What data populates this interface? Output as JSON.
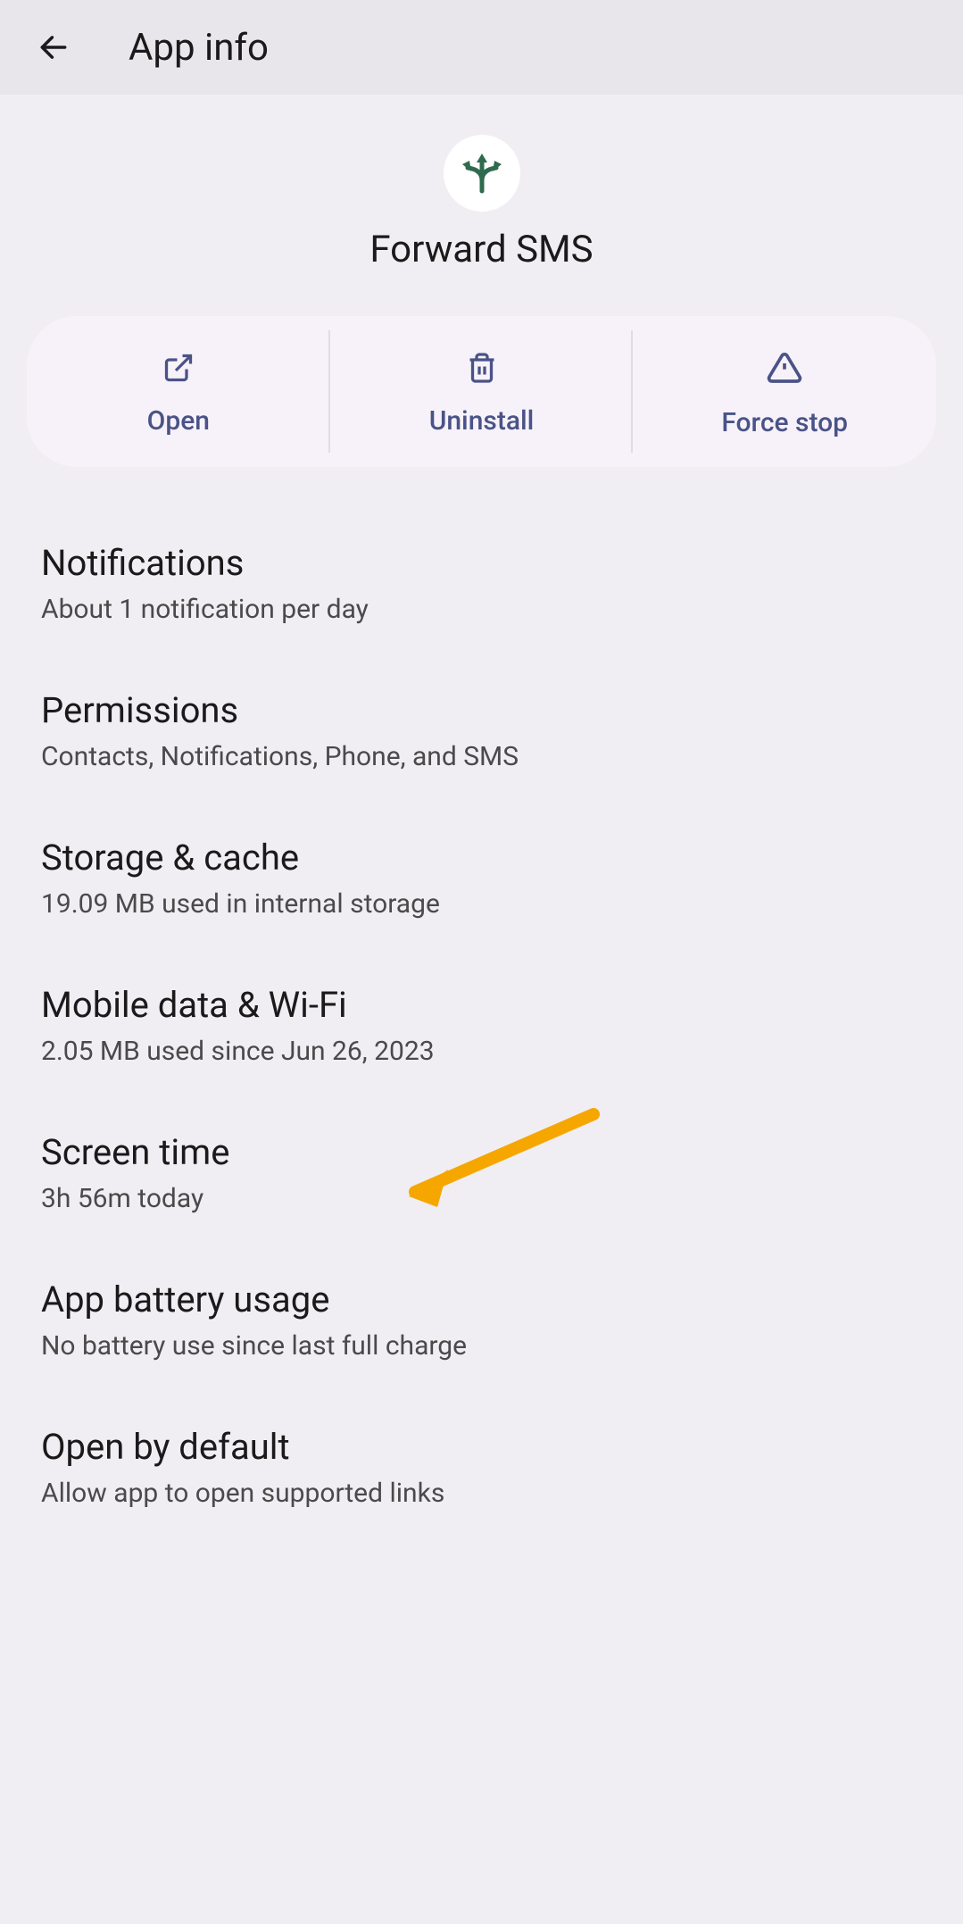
{
  "header": {
    "title": "App info"
  },
  "app": {
    "name": "Forward SMS",
    "icon": "forward-arrows-icon"
  },
  "actions": {
    "open": "Open",
    "uninstall": "Uninstall",
    "force_stop": "Force stop"
  },
  "settings": [
    {
      "title": "Notifications",
      "subtitle": "About 1 notification per day"
    },
    {
      "title": "Permissions",
      "subtitle": "Contacts, Notifications, Phone, and SMS"
    },
    {
      "title": "Storage & cache",
      "subtitle": "19.09 MB used in internal storage"
    },
    {
      "title": "Mobile data & Wi-Fi",
      "subtitle": "2.05 MB used since Jun 26, 2023"
    },
    {
      "title": "Screen time",
      "subtitle": "3h 56m today"
    },
    {
      "title": "App battery usage",
      "subtitle": "No battery use since last full charge"
    },
    {
      "title": "Open by default",
      "subtitle": "Allow app to open supported links"
    }
  ]
}
